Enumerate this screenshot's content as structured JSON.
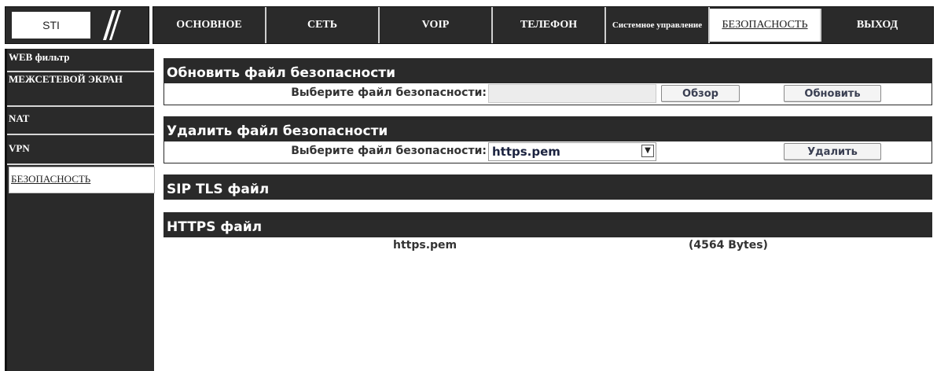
{
  "logo": {
    "text": "STI"
  },
  "tabs": [
    {
      "label": "ОСНОВНОЕ"
    },
    {
      "label": "СЕТЬ"
    },
    {
      "label": "VOIP"
    },
    {
      "label": "ТЕЛЕФОН"
    },
    {
      "label": "Системное управление"
    },
    {
      "label": "БЕЗОПАСНОСТЬ",
      "active": true
    },
    {
      "label": "ВЫХОД"
    }
  ],
  "sidebar": {
    "items": [
      {
        "label": "WEB фильтр"
      },
      {
        "label": "МЕЖСЕТЕВОЙ ЭКРАН"
      },
      {
        "label": "NAT"
      },
      {
        "label": "VPN"
      },
      {
        "label": "БЕЗОПАСНОСТЬ",
        "active": true
      }
    ]
  },
  "update_section": {
    "title": "Обновить файл безопасности",
    "label": "Выберите файл безопасности:",
    "browse_label": "Обзор",
    "update_label": "Обновить"
  },
  "delete_section": {
    "title": "Удалить файл безопасности",
    "label": "Выберите файл безопасности:",
    "selected_file": "https.pem",
    "delete_label": "Удалить"
  },
  "sip_tls_section": {
    "title": "SIP TLS файл"
  },
  "https_section": {
    "title": "HTTPS файл",
    "file_name": "https.pem",
    "file_size": "(4564 Bytes)"
  }
}
